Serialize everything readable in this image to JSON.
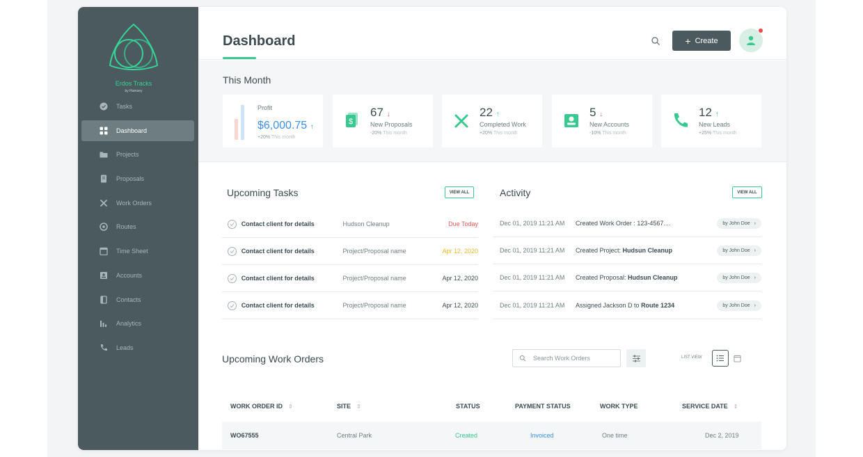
{
  "sidebar": {
    "brand": "Erdos Tracks",
    "brand_sub": "by Ramsey",
    "items": [
      {
        "label": "Tasks",
        "icon": "check-circle-icon"
      },
      {
        "label": "Dashboard",
        "icon": "grid-icon",
        "active": true
      },
      {
        "label": "Projects",
        "icon": "folder-icon"
      },
      {
        "label": "Proposals",
        "icon": "document-icon"
      },
      {
        "label": "Work Orders",
        "icon": "tools-icon"
      },
      {
        "label": "Routes",
        "icon": "route-icon"
      },
      {
        "label": "Time Sheet",
        "icon": "calendar-icon"
      },
      {
        "label": "Accounts",
        "icon": "account-icon"
      },
      {
        "label": "Contacts",
        "icon": "contacts-icon"
      },
      {
        "label": "Analytics",
        "icon": "analytics-icon"
      },
      {
        "label": "Leads",
        "icon": "phone-icon"
      }
    ]
  },
  "header": {
    "title": "Dashboard",
    "create_label": "Create"
  },
  "month": {
    "title": "This Month",
    "cards": [
      {
        "label": "Profit",
        "value": "$6,000.75",
        "trend": "↑",
        "sub": "+20%",
        "sub_muted": "This month"
      },
      {
        "label": "New Proposals",
        "value": "67",
        "trend": "↓",
        "sub": "-20%",
        "sub_muted": "This month"
      },
      {
        "label": "Completed Work",
        "value": "22",
        "trend": "↑",
        "sub": "+20%",
        "sub_muted": "This month"
      },
      {
        "label": "New Accounts",
        "value": "5",
        "trend": "↓",
        "sub": "-10%",
        "sub_muted": "This month"
      },
      {
        "label": "New Leads",
        "value": "12",
        "trend": "↑",
        "sub": "+25%",
        "sub_muted": "This month"
      }
    ]
  },
  "tasks": {
    "title": "Upcoming Tasks",
    "view_all": "VIEW ALL",
    "rows": [
      {
        "title": "Contact client for details",
        "project": "Hudson Cleanup",
        "due": "Due Today",
        "due_color": "#ef5a5a"
      },
      {
        "title": "Contact client for details",
        "project": "Project/Proposal name",
        "due": "Apr 12, 2020",
        "due_color": "#f2b632"
      },
      {
        "title": "Contact client for details",
        "project": "Project/Proposal name",
        "due": "Apr 12, 2020",
        "due_color": "#3b4a4e"
      },
      {
        "title": "Contact client for details",
        "project": "Project/Proposal name",
        "due": "Apr 12, 2020",
        "due_color": "#3b4a4e"
      }
    ]
  },
  "activity": {
    "title": "Activity",
    "view_all": "VIEW ALL",
    "rows": [
      {
        "time": "Dec 01, 2019 11:21 AM",
        "prefix": "Created Work Order : 123-4567....",
        "bold": "",
        "by": "by John Doe"
      },
      {
        "time": "Dec 01, 2019 11:21 AM",
        "prefix": "Created Project: ",
        "bold": "Hudsun Cleanup",
        "by": "by John Doe"
      },
      {
        "time": "Dec 01, 2019 11:21 AM",
        "prefix": "Created Proposal: ",
        "bold": "Hudsun Cleanup",
        "by": "by John Doe"
      },
      {
        "time": "Dec 01, 2019 11:21 AM",
        "prefix": "Assigned Jackson D to ",
        "bold": "Route 1234",
        "by": "by John Doe"
      }
    ]
  },
  "work_orders": {
    "title": "Upcoming Work Orders",
    "search_placeholder": "Search Work Orders",
    "list_view_label": "LIST VIEW",
    "columns": [
      "WORK ORDER ID",
      "SITE",
      "STATUS",
      "PAYMENT STATUS",
      "WORK TYPE",
      "SERVICE DATE"
    ],
    "rows": [
      {
        "id": "WO67555",
        "site": "Central Park",
        "status": "Created",
        "payment": "Invoiced",
        "type": "One time",
        "date": "Dec 2, 2019"
      }
    ]
  },
  "colors": {
    "sidebar": "#4b5a5d",
    "accent": "#37c98f",
    "danger": "#ef5a5a",
    "warning": "#f2b632",
    "info": "#3c8ee8"
  }
}
